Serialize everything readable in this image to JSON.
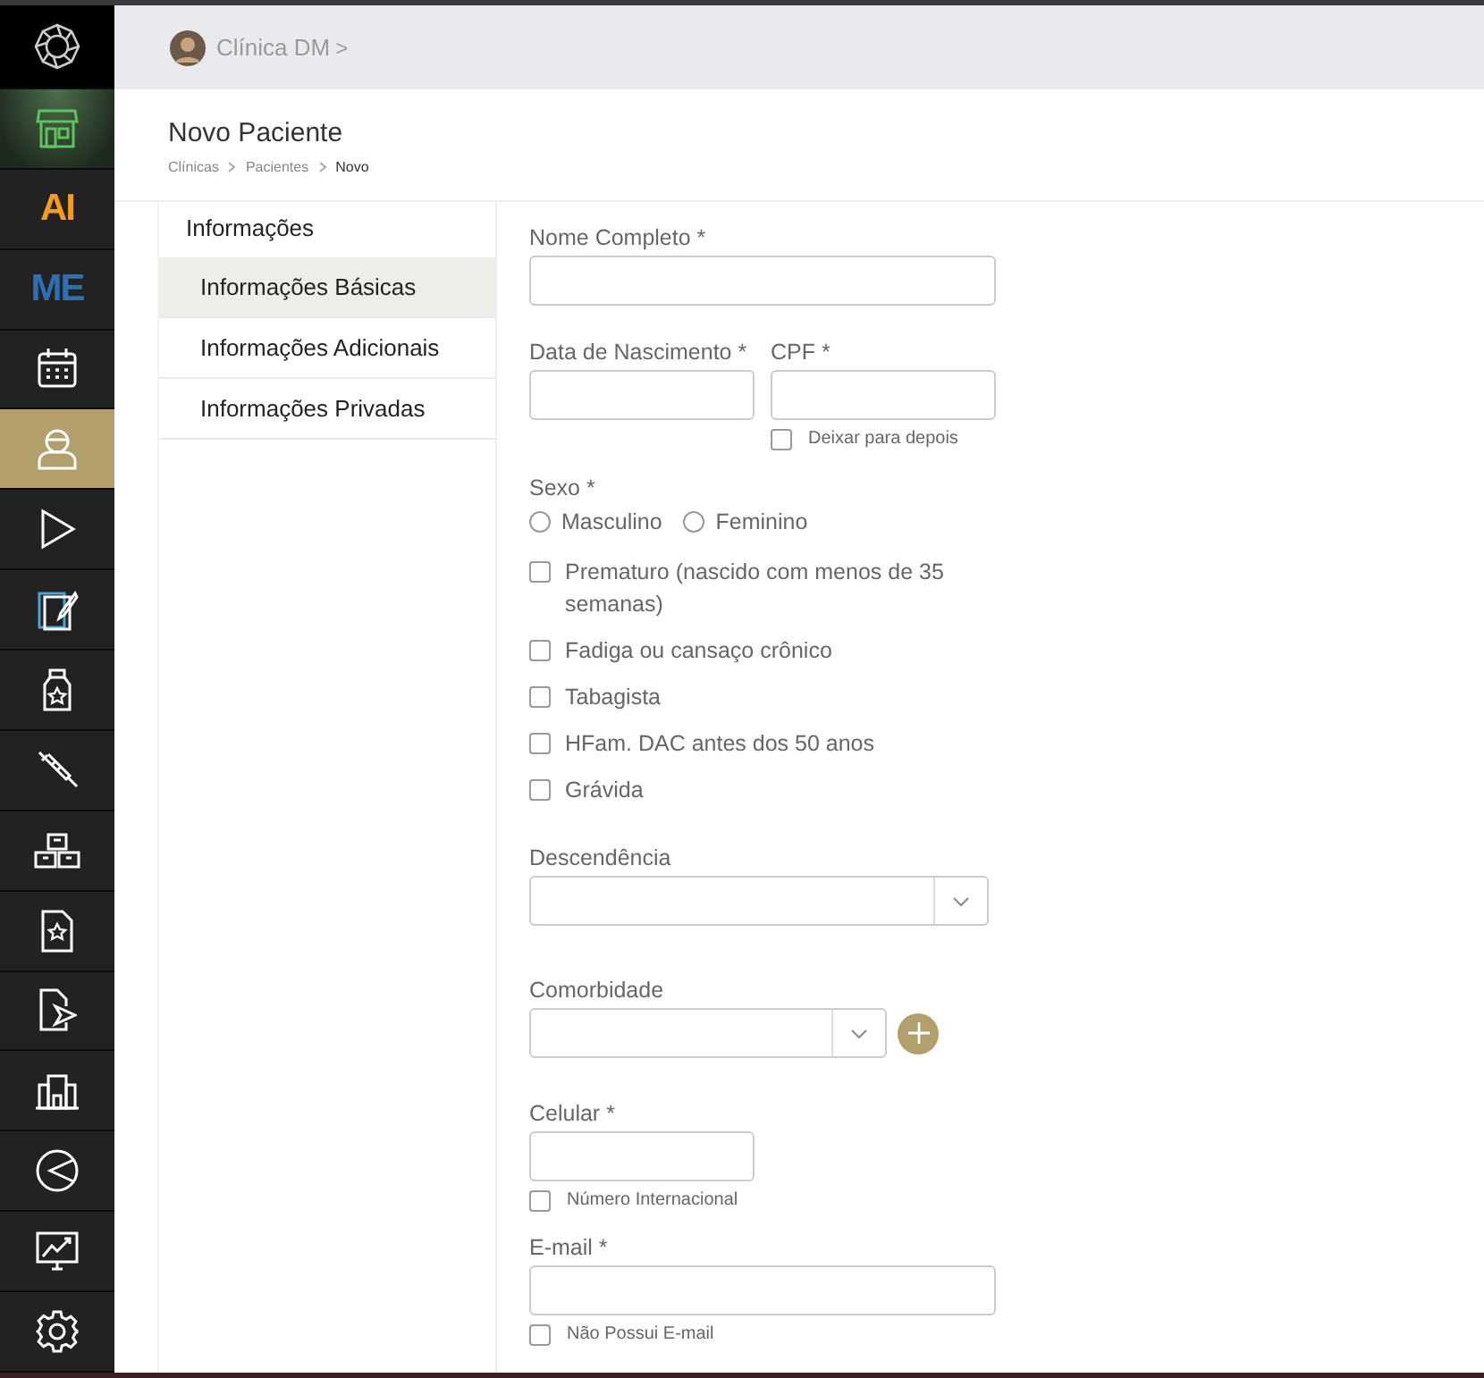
{
  "sidebar": {
    "items": [
      {
        "kind": "logo",
        "selected": false
      },
      {
        "kind": "store",
        "selected": false
      },
      {
        "kind": "text",
        "label": "AI",
        "color": "#f39c1f",
        "selected": false
      },
      {
        "kind": "text",
        "label": "ME",
        "color": "#2f6fb0",
        "selected": false
      },
      {
        "kind": "calendar",
        "selected": false
      },
      {
        "kind": "person",
        "selected": true
      },
      {
        "kind": "play",
        "selected": false
      },
      {
        "kind": "notes",
        "selected": false
      },
      {
        "kind": "bottle",
        "selected": false
      },
      {
        "kind": "syringe",
        "selected": false
      },
      {
        "kind": "boxes",
        "selected": false
      },
      {
        "kind": "doc-star",
        "selected": false
      },
      {
        "kind": "doc-send",
        "selected": false
      },
      {
        "kind": "buildings",
        "selected": false
      },
      {
        "kind": "pie",
        "selected": false
      },
      {
        "kind": "monitor",
        "selected": false
      },
      {
        "kind": "gear",
        "selected": false
      }
    ]
  },
  "topbar": {
    "clinic": "Clínica DM",
    "chevron": ">"
  },
  "page": {
    "title": "Novo Paciente",
    "breadcrumb": [
      "Clínicas",
      "Pacientes",
      "Novo"
    ]
  },
  "section_nav": {
    "heading": "Informações",
    "items": [
      {
        "label": "Informações Básicas",
        "selected": true
      },
      {
        "label": "Informações Adicionais",
        "selected": false
      },
      {
        "label": "Informações Privadas",
        "selected": false
      }
    ]
  },
  "form": {
    "items": [
      {
        "kind": "text",
        "label": "Nome Completo *",
        "wide": true
      },
      {
        "kind": "pair",
        "fields": [
          {
            "label": "Data de Nascimento *"
          },
          {
            "label": "CPF *",
            "option": {
              "label": "Deixar para depois",
              "checked": false
            }
          }
        ]
      },
      {
        "kind": "radio",
        "label": "Sexo *",
        "options": [
          {
            "label": "Masculino",
            "selected": false
          },
          {
            "label": "Feminino",
            "selected": false
          }
        ]
      },
      {
        "kind": "checkbox",
        "label": "Prematuro (nascido com menos de 35 semanas)",
        "checked": false
      },
      {
        "kind": "checkbox",
        "label": "Fadiga ou cansaço crônico",
        "checked": false
      },
      {
        "kind": "checkbox",
        "label": "Tabagista",
        "checked": false
      },
      {
        "kind": "checkbox",
        "label": "HFam. DAC antes dos 50 anos",
        "checked": false
      },
      {
        "kind": "checkbox",
        "label": "Grávida",
        "checked": false
      },
      {
        "kind": "select",
        "label": "Descendência",
        "wide": true,
        "add": false
      },
      {
        "kind": "select",
        "label": "Comorbidade",
        "wide": false,
        "add": true
      },
      {
        "kind": "text",
        "label": "Celular *",
        "wide": false,
        "option": {
          "label": "Número Internacional",
          "checked": false
        }
      },
      {
        "kind": "text",
        "label": "E-mail *",
        "wide": true,
        "option": {
          "label": "Não Possui E-mail",
          "checked": false
        }
      }
    ]
  }
}
